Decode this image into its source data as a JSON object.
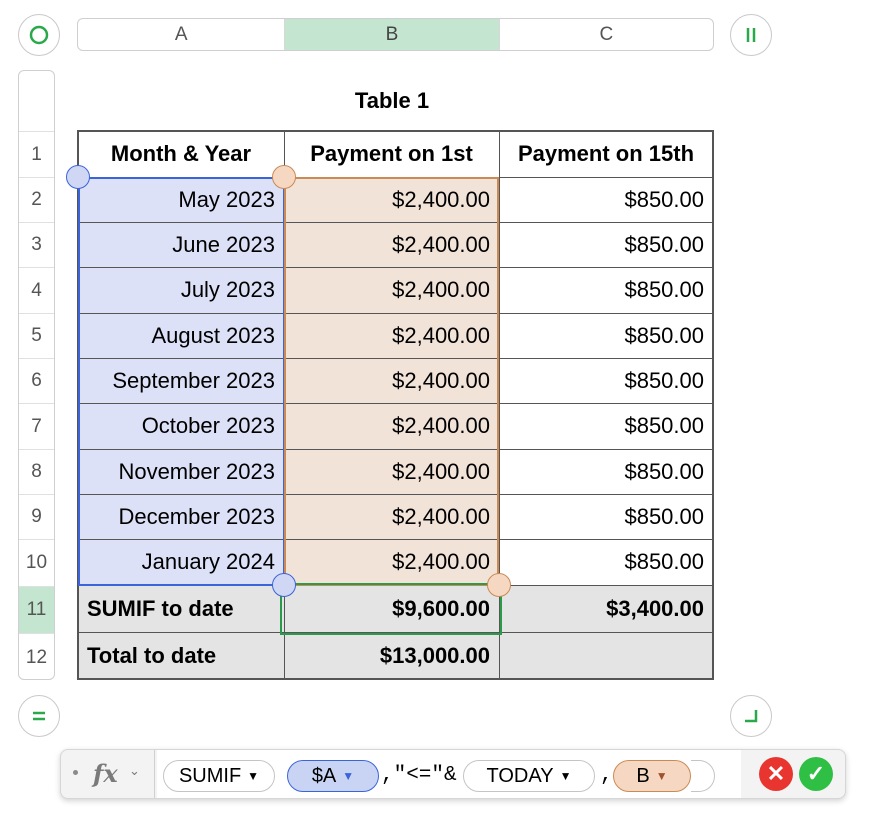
{
  "columns": [
    "A",
    "B",
    "C"
  ],
  "selected_column": "B",
  "rows": [
    "1",
    "2",
    "3",
    "4",
    "5",
    "6",
    "7",
    "8",
    "9",
    "10",
    "11",
    "12"
  ],
  "selected_row": "11",
  "table": {
    "title": "Table 1",
    "headers": [
      "Month & Year",
      "Payment on 1st",
      "Payment on 15th"
    ],
    "data_rows": [
      [
        "May 2023",
        "$2,400.00",
        "$850.00"
      ],
      [
        "June 2023",
        "$2,400.00",
        "$850.00"
      ],
      [
        "July 2023",
        "$2,400.00",
        "$850.00"
      ],
      [
        "August 2023",
        "$2,400.00",
        "$850.00"
      ],
      [
        "September 2023",
        "$2,400.00",
        "$850.00"
      ],
      [
        "October 2023",
        "$2,400.00",
        "$850.00"
      ],
      [
        "November 2023",
        "$2,400.00",
        "$850.00"
      ],
      [
        "December 2023",
        "$2,400.00",
        "$850.00"
      ],
      [
        "January 2024",
        "$2,400.00",
        "$850.00"
      ]
    ],
    "footer_rows": [
      [
        "SUMIF to date",
        "$9,600.00",
        "$3,400.00"
      ],
      [
        "Total to date",
        "$13,000.00",
        ""
      ]
    ]
  },
  "formula_bar": {
    "fx_label": "fx",
    "function_token": "SUMIF",
    "arg1_token": "$A",
    "literal": ",\"<=\"&",
    "today_token": "TODAY",
    "comma": ",",
    "arg3_token": "B"
  },
  "colors": {
    "selection_green": "#c4e6d0",
    "range_blue_fill": "#dde1f7",
    "range_blue_border": "#3a64d8",
    "range_orange_fill": "#f2e3d9",
    "range_orange_border": "#c98a55",
    "footer_gray": "#e4e4e4",
    "cancel_red": "#e8352f",
    "accept_green": "#2fbf44"
  },
  "icons": {
    "table_select": "circle-icon",
    "freeze_columns": "pause-bars-icon",
    "row_menu": "equals-icon",
    "resize_corner": "corner-icon",
    "cancel": "x-icon",
    "accept": "checkmark-icon"
  }
}
